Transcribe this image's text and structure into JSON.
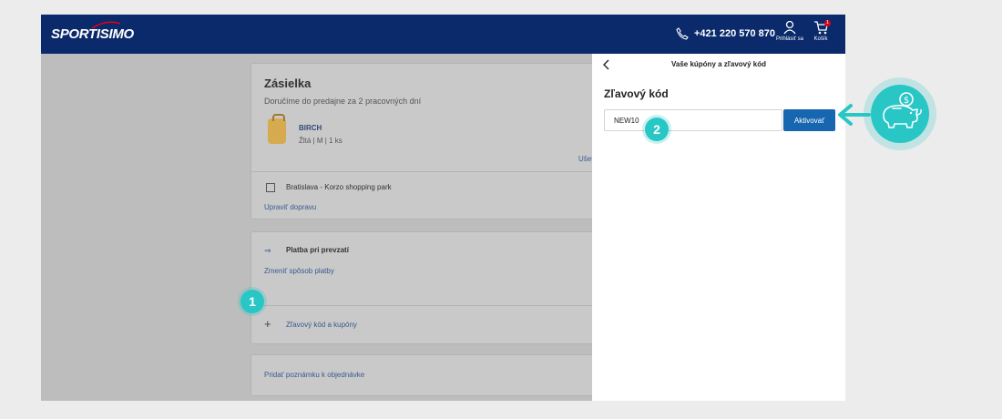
{
  "header": {
    "logo": "SPORTISIMO",
    "phone": "+421 220 570 870",
    "login_label": "Prihlásiť sa",
    "cart_label": "Košík",
    "cart_count": "1"
  },
  "shipment": {
    "title": "Zásielka",
    "subtitle": "Doručíme do predajne za 2 pracovných dní",
    "product_name": "BIRCH",
    "product_variant": "Žltá | M | 1 ks",
    "cut_link": "Ušet",
    "store": "Bratislava - Korzo shopping park",
    "change_shipping": "Upraviť dopravu"
  },
  "payment": {
    "method": "Platba pri prevzatí",
    "change": "Zmeniť spôsob platby",
    "coupon_toggle": "Zľavový kód a kupóny"
  },
  "note": {
    "label": "Pridať poznámku k objednávke"
  },
  "drawer": {
    "title": "Vaše kúpóny a zľavový kód",
    "section_title": "Zľavový kód",
    "code_value": "NEW10",
    "activate_label": "Aktivovať"
  },
  "steps": {
    "one": "1",
    "two": "2"
  },
  "colors": {
    "header": "#0a2a6b",
    "accent_button": "#1766b0",
    "annotation": "#29c6c6"
  }
}
